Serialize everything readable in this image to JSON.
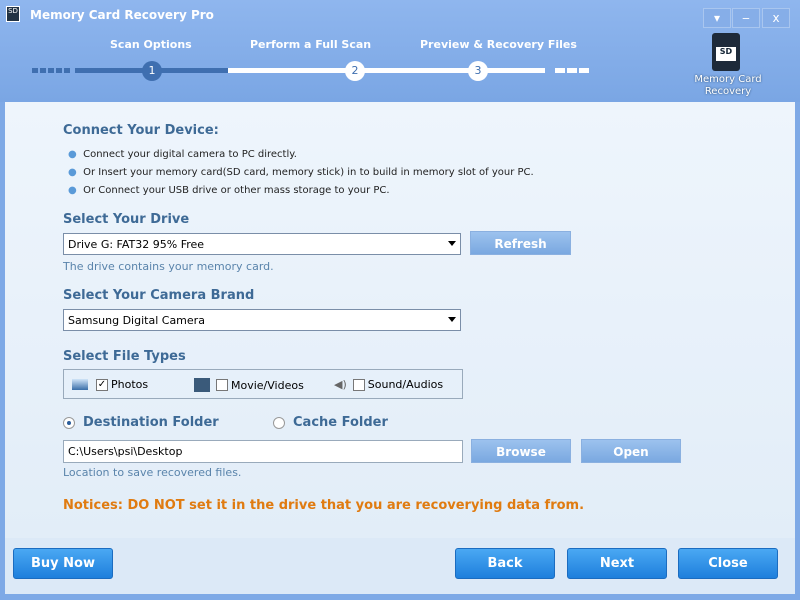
{
  "window": {
    "title": "Memory Card Recovery Pro",
    "controls": [
      "▾",
      "‒",
      "x"
    ]
  },
  "steps": [
    {
      "label": "Scan Options",
      "num": "1"
    },
    {
      "label": "Perform a Full Scan",
      "num": "2"
    },
    {
      "label": "Preview & Recovery Files",
      "num": "3"
    }
  ],
  "current_step": 1,
  "logo": {
    "sd": "SD",
    "label": "Memory Card Recovery"
  },
  "connect": {
    "title": "Connect Your Device:",
    "items": [
      "Connect your digital camera to PC directly.",
      "Or Insert your memory card(SD card, memory stick) in to build in memory slot of your PC.",
      "Or Connect your USB drive or other mass storage to your PC."
    ]
  },
  "drive": {
    "title": "Select Your Drive",
    "value": "Drive G: FAT32 95% Free",
    "refresh": "Refresh",
    "hint": "The drive contains your memory card."
  },
  "camera": {
    "title": "Select Your Camera Brand",
    "value": "Samsung Digital Camera"
  },
  "filetypes": {
    "title": "Select File Types",
    "photos": "Photos",
    "photos_checked": true,
    "videos": "Movie/Videos",
    "videos_checked": false,
    "audio": "Sound/Audios",
    "audio_checked": false
  },
  "folder": {
    "destination": "Destination Folder",
    "cache": "Cache Folder",
    "selected": "destination",
    "path": "C:\\Users\\psi\\Desktop",
    "browse": "Browse",
    "open": "Open",
    "hint": "Location to save recovered files."
  },
  "notice": "Notices: DO NOT set it in the drive that you are recoverying data from.",
  "footer": {
    "buy": "Buy Now",
    "back": "Back",
    "next": "Next",
    "close": "Close"
  }
}
